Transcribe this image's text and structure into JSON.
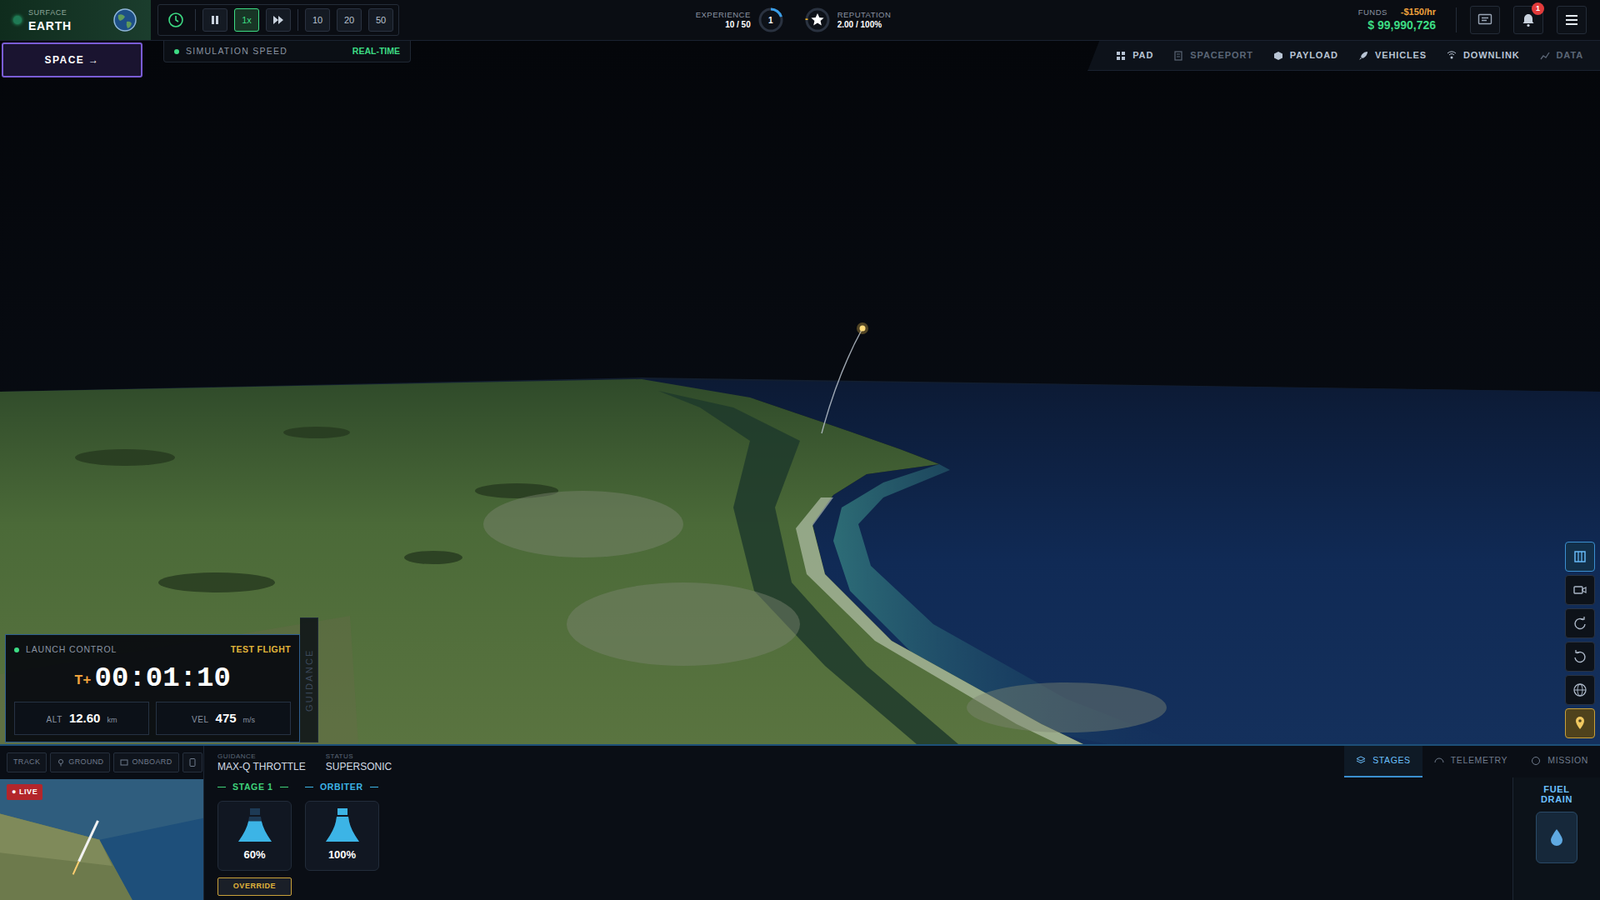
{
  "location": {
    "label": "SURFACE",
    "name": "EARTH"
  },
  "time_controls": [
    {
      "kind": "clock",
      "selected": false
    },
    {
      "kind": "pause",
      "selected": false
    },
    {
      "kind": "speed",
      "label": "1x",
      "selected": true
    },
    {
      "kind": "forward",
      "selected": false
    },
    {
      "kind": "speed",
      "label": "10",
      "selected": false
    },
    {
      "kind": "speed",
      "label": "20",
      "selected": false
    },
    {
      "kind": "speed",
      "label": "50",
      "selected": false
    }
  ],
  "space_button": {
    "label": "SPACE →"
  },
  "simulation_speed": {
    "label": "SIMULATION SPEED",
    "value": "REAL-TIME"
  },
  "experience": {
    "label": "EXPERIENCE",
    "value": "10 / 50",
    "level": 0.2,
    "rank": "1"
  },
  "reputation": {
    "label": "REPUTATION",
    "value": "2.00 / 100%",
    "level": 0.02
  },
  "funds": {
    "label": "FUNDS",
    "rate": "-$150/hr",
    "amount": "$ 99,990,726"
  },
  "notifications": {
    "count": "1"
  },
  "nav_tabs": [
    {
      "label": "PAD",
      "disabled": false
    },
    {
      "label": "SPACEPORT",
      "disabled": true
    },
    {
      "label": "PAYLOAD",
      "disabled": false
    },
    {
      "label": "VEHICLES",
      "disabled": false
    },
    {
      "label": "DOWNLINK",
      "disabled": false
    },
    {
      "label": "DATA",
      "disabled": true
    }
  ],
  "side_tools": [
    {
      "kind": "map",
      "selected": true
    },
    {
      "kind": "camera",
      "selected": false
    },
    {
      "kind": "rotate",
      "selected": false
    },
    {
      "kind": "reset",
      "selected": false
    },
    {
      "kind": "globe",
      "selected": false
    },
    {
      "kind": "pin",
      "selected": true
    }
  ],
  "launch_control": {
    "title": "LAUNCH CONTROL",
    "mode": "TEST FLIGHT",
    "clock_prefix": "T+",
    "clock": "00:01:10",
    "readouts": [
      {
        "label": "ALT",
        "value": "12.60",
        "unit": "km"
      },
      {
        "label": "VEL",
        "value": "475",
        "unit": "m/s"
      }
    ],
    "side_tab": "GUIDANCE"
  },
  "camera": {
    "modes": [
      {
        "label": "TRACK",
        "selected": false
      },
      {
        "label": "GROUND",
        "selected": false
      },
      {
        "label": "ONBOARD",
        "selected": false
      }
    ],
    "live": "LIVE"
  },
  "flight_status": [
    {
      "label": "GUIDANCE",
      "value": "MAX-Q THROTTLE"
    },
    {
      "label": "STATUS",
      "value": "SUPERSONIC"
    }
  ],
  "stages": [
    {
      "name": "STAGE 1",
      "level": 0.6,
      "reading": "60%",
      "color": "#3fd27a",
      "button": "OVERRIDE"
    },
    {
      "name": "ORBITER",
      "level": 1,
      "reading": "100%",
      "color": "#3cb4e6"
    }
  ],
  "panel_tabs": [
    {
      "label": "STAGES",
      "selected": true
    },
    {
      "label": "TELEMETRY",
      "selected": false
    },
    {
      "label": "MISSION",
      "selected": false
    }
  ],
  "fuel_drain": {
    "label": "FUEL DRAIN"
  }
}
